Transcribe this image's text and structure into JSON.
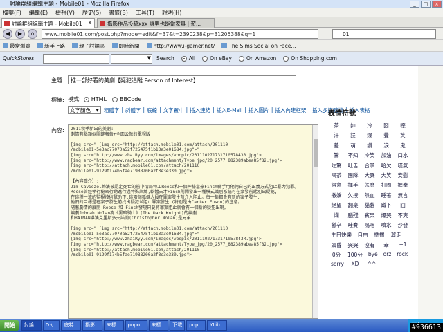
{
  "window": {
    "title": "討論群組編輯主題 - Mobile01 - Mozilla Firefox"
  },
  "menu": [
    "檔案(F)",
    "編輯(E)",
    "檢視(V)",
    "歷史(S)",
    "書籤(B)",
    "工具(T)",
    "說明(H)"
  ],
  "tabs": [
    {
      "label": "討論群組編輯主題 - Mobile01",
      "active": true
    },
    {
      "label": "攝影作品投稿xxx 讓男也能當家具 | 遊...",
      "active": false
    }
  ],
  "url": "www.mobile01.com/post.php?mode=edit&f=37&t=2390238&p=31205388&q=1",
  "search": {
    "value": "01"
  },
  "bookmarks": [
    "最常瀏覽",
    "新手上路",
    "親子討論區",
    "即時新聞",
    "http://www.i-gamer.net/",
    "The Sims Social on Face..."
  ],
  "quickstores": {
    "label": "QuickStores",
    "search_label": "Search",
    "options": [
      "All",
      "On eBay",
      "On Amazon",
      "On Shopping.com"
    ]
  },
  "form": {
    "subject_label": "主題:",
    "subject_value": "推一部好看的美劇【疑犯追蹤 Person of Interest】",
    "mode_label": "標籤:",
    "mode_prefix": "模式:",
    "mode_html": "HTML",
    "mode_bbcode": "BBCode",
    "color_select": "文字顏色",
    "format_items": [
      "粗體字",
      "斜體字",
      "底線",
      "文字置中",
      "插入連結",
      "插入E-Mail",
      "插入圖片",
      "插入內建框架",
      "插入多媒體檔",
      "插入表格"
    ],
    "content_label": "內容:",
    "body_lines": [
      "2011秋季新出的美劇:",
      "劇情有點類似關鍵報告+全面公敵的電視版",
      "",
      "[img src=\"  [img src=\"http://attach.mobile01.com/attach/201110",
      "/mobile01-5e3ac77070a52f725475f1b13a3e01684.jpg\">\"",
      "[img src=\"http://www.zhaiRyy.com/images/vodpic/20111027173171057843R.jpg\">",
      "[img src=\"http://www.ragbear.com/attachment/Type_jpg/20_2577_882389abea85f82.jpg\">",
      "[img src=\"http://attach.mobile01.com/attach/201110",
      "/mobile01-9129f174b5fae71988200a2f3e3e330.jpg\">",
      "",
      "【內容簡介】:",
      "Jim Caviezel飾演被認定死亡的前中情局特工Reese和一個神秘富豪Finch聯手用他們自己的正義方式阻止暴力犯罪。",
      "Reese曾經執行秘密行動進行過特殊訓練,軟體天才Finch則開發出一種模式識別系統可在案發前鑑別出疑犯,",
      "在這種一流的監視技術幫助下,這兩個孤僻人員在罪案發生前介入阻止。每一集都會有新的案子發生,",
      "他們的目標是在案子發生前找出疑犯並阻止罪案發生 (特別是由Carter,Fusco)的注意。",
      "隨著劇情的展開 Reese 和 Finch發現只要將罪案阻止就會有一個新的疑犯出現。",
      "編劇Johnah Nolan為《黑暗騎士》(The Dark Knight)的編劇",
      "和BATMAN導演克里斯多夫諾蘭(Christopher Nolan)是兄弟",
      "",
      "[img src=\"  [img src=\"http://attach.mobile01.com/attach/201110",
      "/mobile01-5e3ac77070a52f725475f1b13a3e01684.jpg\">\"",
      "[img src=\"http://www.zhaiRyy.com/images/vodpic/20111027173171057843R.jpg\">",
      "[img src=\"http://www.ragbear.com/attachment/Type_jpg/20_2577_882389abea85f82.jpg\">",
      "[img src=\"http://attach.mobile01.com/attach/201110",
      "/mobile01-9129f174b5fae71988200a2f3e3e330.jpg\">"
    ]
  },
  "emoticons": {
    "title": "表情符號",
    "items": [
      "茶",
      "帥",
      "冷",
      "囧",
      "噁",
      "汗",
      "誤",
      "爆",
      "疊",
      "笑",
      "羞",
      "萌",
      "讚",
      "淚",
      "鬼",
      "驚",
      "不知",
      "冷笑",
      "加油",
      "口水",
      "吃驚",
      "吐舌",
      "合掌",
      "哈欠",
      "嘆氣",
      "喝茶",
      "團隊",
      "大哭",
      "大笑",
      "安慰",
      "得意",
      "揮手",
      "怎麼",
      "打圈",
      "握拳",
      "撒嬌",
      "欠揍",
      "熱血",
      "睡著",
      "無言",
      "絕望",
      "翻桌",
      "貓貓",
      "蹲下",
      "囧",
      "爛",
      "腦殘",
      "賓果",
      "爆哭",
      "不爽",
      "鬱卒",
      "哇賽",
      "嗚咽",
      "噴水",
      "沙發",
      "生日快樂",
      "自由",
      "揣揣",
      "溜走",
      "頭昏",
      "哭哭",
      "沒有",
      "幸",
      "+1",
      "0分",
      "100分",
      "bye",
      "orz",
      "rock",
      "sorry",
      "XD",
      "^^"
    ]
  },
  "taskbar": {
    "start": "開始",
    "tasks": [
      "討論...",
      "D:\\...",
      "底特...",
      "攝影...",
      "未標...",
      "popo...",
      "未標...",
      "下載",
      "pop...",
      "YLib..."
    ],
    "tray": "下午 03:07"
  },
  "watermark": "#936613"
}
